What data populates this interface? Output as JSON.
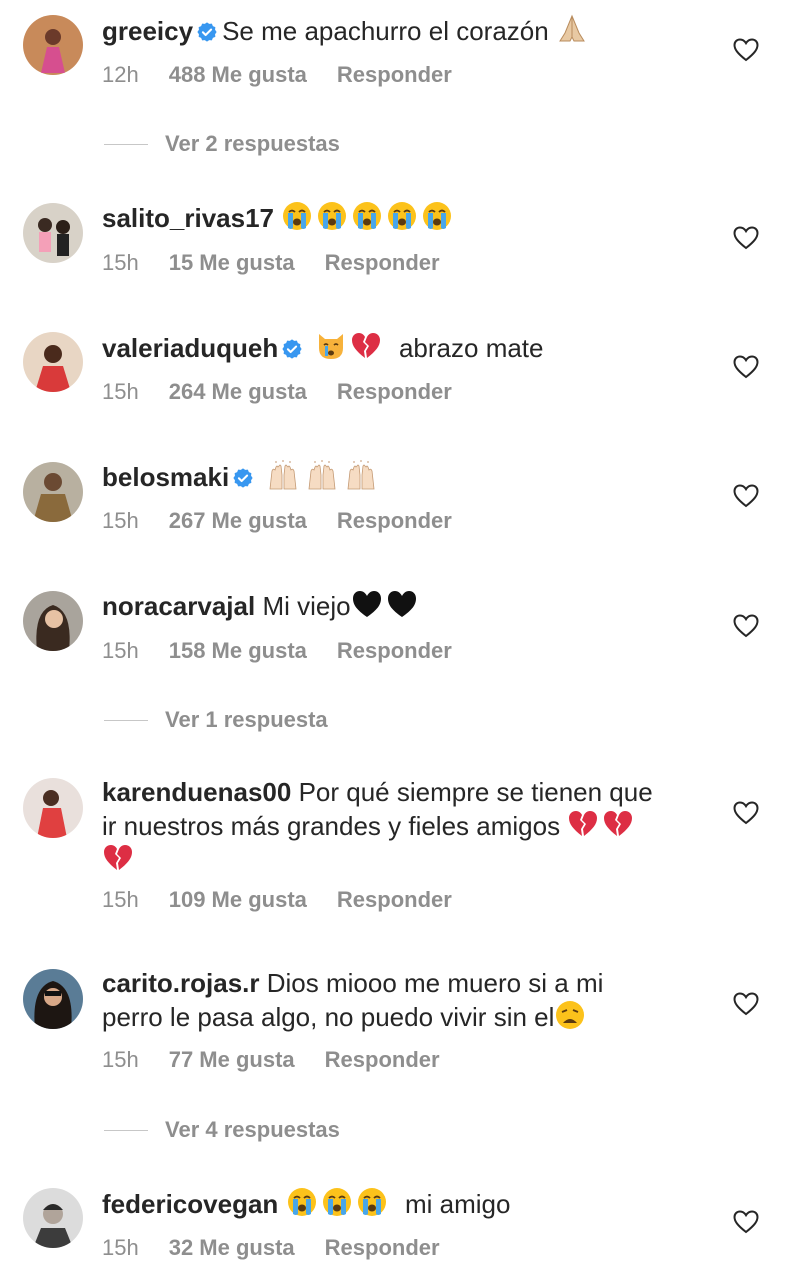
{
  "comments": [
    {
      "username": "greeicy",
      "verified": true,
      "text": "Se me apachurro el corazón",
      "emojis": [
        "folded-hands"
      ],
      "time": "12h",
      "likes": "488 Me gusta",
      "reply": "Responder",
      "view_replies": "Ver 2 respuestas"
    },
    {
      "username": "salito_rivas17",
      "verified": false,
      "text": "",
      "emojis": [
        "crying-face",
        "crying-face",
        "crying-face",
        "crying-face",
        "crying-face"
      ],
      "time": "15h",
      "likes": "15 Me gusta",
      "reply": "Responder"
    },
    {
      "username": "valeriaduqueh",
      "verified": true,
      "text": "abrazo mate",
      "emojis": [
        "crying-cat",
        "broken-heart"
      ],
      "time": "15h",
      "likes": "264 Me gusta",
      "reply": "Responder"
    },
    {
      "username": "belosmaki",
      "verified": true,
      "text": "",
      "emojis": [
        "raising-hands",
        "raising-hands",
        "raising-hands"
      ],
      "time": "15h",
      "likes": "267 Me gusta",
      "reply": "Responder"
    },
    {
      "username": "noracarvajal",
      "verified": false,
      "text": "Mi viejo",
      "emojis": [
        "black-heart",
        "black-heart"
      ],
      "time": "15h",
      "likes": "158 Me gusta",
      "reply": "Responder",
      "view_replies": "Ver 1 respuesta"
    },
    {
      "username": "karenduenas00",
      "verified": false,
      "text_line1": "Por qué siempre se tienen que",
      "text_line2": "ir nuestros más grandes y fieles amigos",
      "emojis": [
        "broken-heart",
        "broken-heart",
        "broken-heart"
      ],
      "time": "15h",
      "likes": "109 Me gusta",
      "reply": "Responder"
    },
    {
      "username": "carito.rojas.r",
      "verified": false,
      "text_line1": "Dios miooo me muero si a mi",
      "text_line2": "perro le pasa algo, no puedo vivir sin el",
      "emojis": [
        "weary-face"
      ],
      "time": "15h",
      "likes": "77 Me gusta",
      "reply": "Responder",
      "view_replies": "Ver 4 respuestas"
    },
    {
      "username": "federicovegan",
      "verified": false,
      "text": "mi amigo",
      "emojis": [
        "crying-face",
        "crying-face",
        "crying-face"
      ],
      "time": "15h",
      "likes": "32 Me gusta",
      "reply": "Responder"
    }
  ],
  "colors": {
    "text": "#262626",
    "meta": "#8e8e8e",
    "verified": "#3897f0",
    "divider": "#c7c7c7"
  },
  "icons": {
    "like": "heart-outline-icon",
    "verified": "verified-badge-icon"
  }
}
